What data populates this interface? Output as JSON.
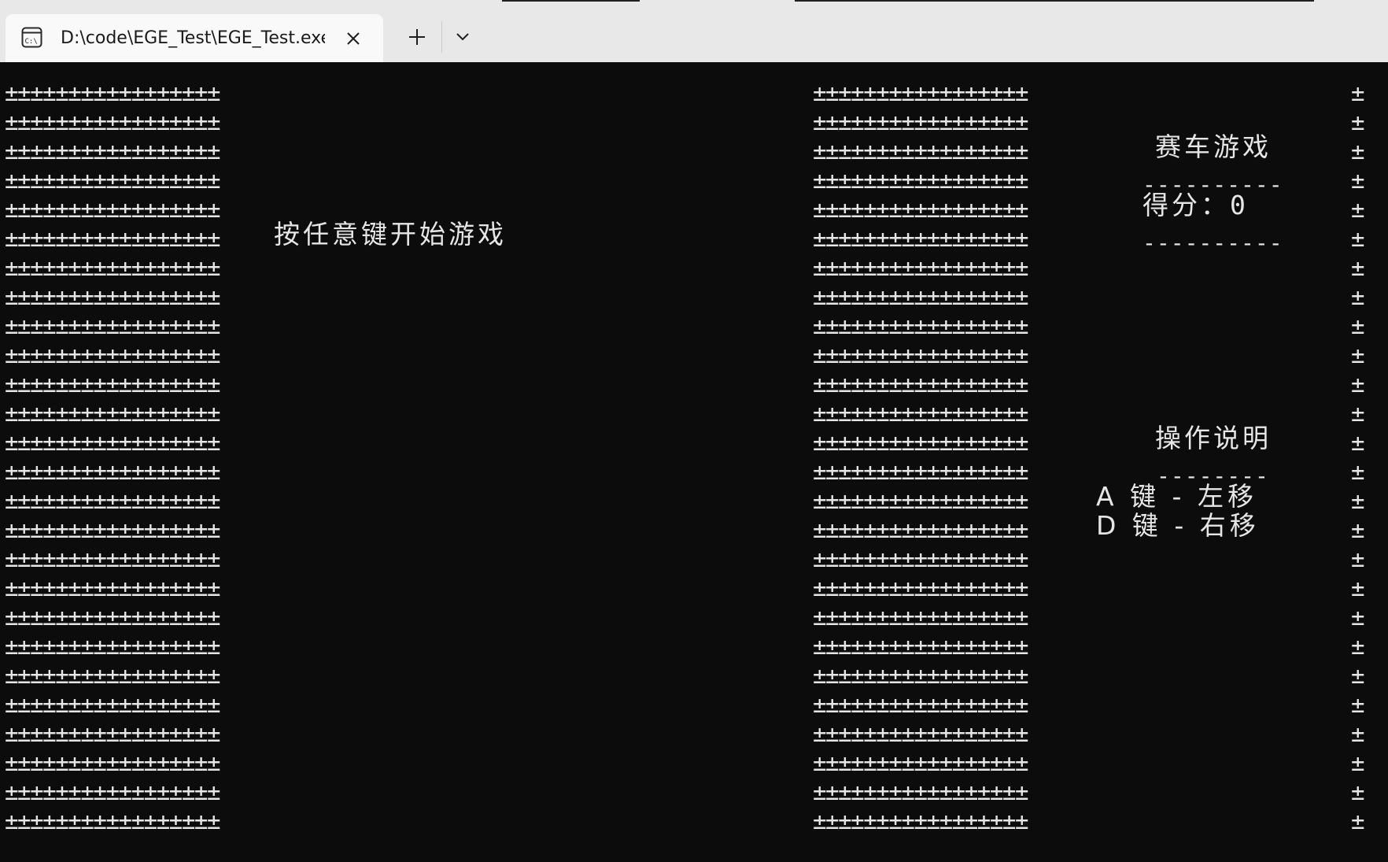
{
  "window": {
    "tab_title": "D:\\code\\EGE_Test\\EGE_Test.exe",
    "tab_icon": "console-icon",
    "close_icon": "close-icon",
    "new_tab_icon": "plus-icon",
    "dropdown_icon": "chevron-down-icon"
  },
  "console": {
    "left_wall_row": "±±±±±±±±±±±±±±±±±",
    "right_wall_row": "±±±±±±±±±±±±±±±±±",
    "border_char": "±",
    "row_count": 26,
    "start_prompt": "按任意键开始游戏",
    "game_title": "赛车游戏",
    "score_divider_top": "----------",
    "score_label": "得分：",
    "score_value": "0",
    "score_divider_bottom": "----------",
    "help_title": "操作说明",
    "help_divider": "--------",
    "key_a_help": "A 键 - 左移",
    "key_d_help": "D 键 - 右移"
  },
  "colors": {
    "console_bg": "#0c0c0c",
    "console_fg": "#e6e6e6",
    "tabbar_bg": "#e8e8e8",
    "active_tab_bg": "#f9f9f9"
  }
}
